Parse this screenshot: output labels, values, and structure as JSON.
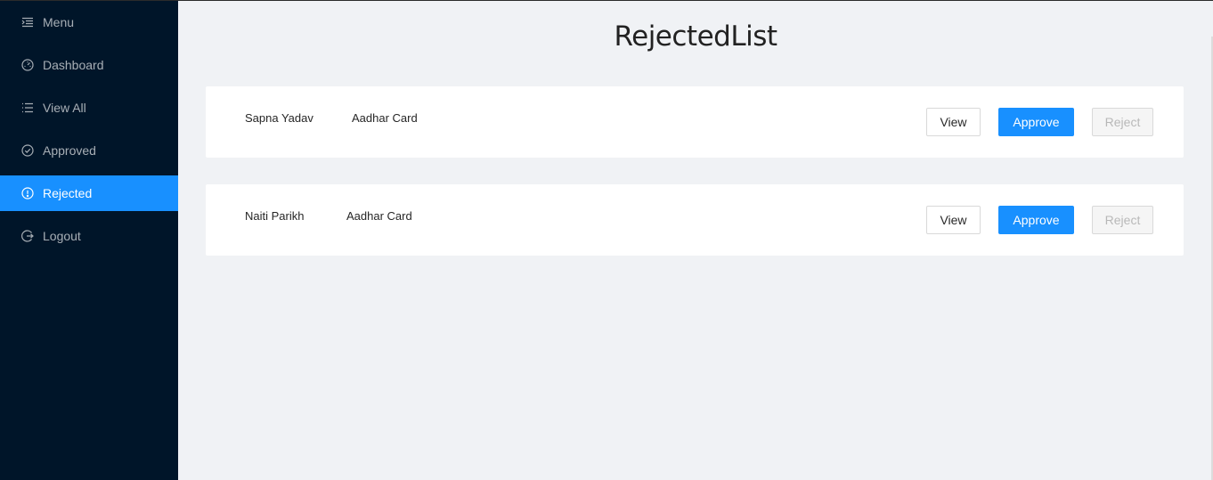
{
  "sidebar": {
    "items": [
      {
        "label": "Menu",
        "icon": "menu-icon",
        "selected": false
      },
      {
        "label": "Dashboard",
        "icon": "dashboard-icon",
        "selected": false
      },
      {
        "label": "View All",
        "icon": "list-icon",
        "selected": false
      },
      {
        "label": "Approved",
        "icon": "check-circle-icon",
        "selected": false
      },
      {
        "label": "Rejected",
        "icon": "exclamation-circle-icon",
        "selected": true
      },
      {
        "label": "Logout",
        "icon": "logout-icon",
        "selected": false
      }
    ]
  },
  "main": {
    "title": "RejectedList",
    "records": [
      {
        "name": "Sapna Yadav",
        "document": "Aadhar Card",
        "view_label": "View",
        "approve_label": "Approve",
        "reject_label": "Reject"
      },
      {
        "name": "Naiti Parikh",
        "document": "Aadhar Card",
        "view_label": "View",
        "approve_label": "Approve",
        "reject_label": "Reject"
      }
    ]
  },
  "colors": {
    "sidebar_bg": "#001529",
    "selected_bg": "#1890ff",
    "page_bg": "#f0f2f5",
    "primary": "#1890ff"
  }
}
